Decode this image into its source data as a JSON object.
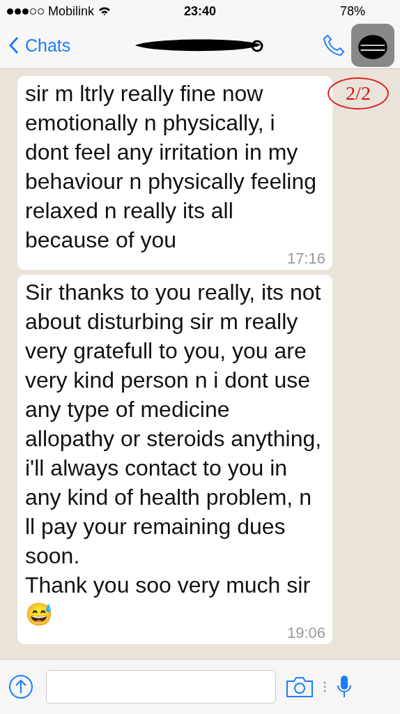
{
  "status_bar": {
    "carrier": "Mobilink",
    "time": "23:40",
    "battery": "78%"
  },
  "nav": {
    "back_label": "Chats"
  },
  "annotation": "2/2",
  "messages": [
    {
      "text": "sir m ltrly really fine now emotionally n physically, i dont feel any irritation in my behaviour n physically feeling relaxed n really its all because of you",
      "time": "17:16"
    },
    {
      "text": "Sir thanks to you really, its not about disturbing sir m really very gratefull to you, you are very kind person n i dont use any type of medicine allopathy or steroids anything, i'll always contact to you in any kind of health problem, n ll pay your remaining dues soon.\nThank you soo very much sir😅",
      "time": "19:06"
    }
  ]
}
